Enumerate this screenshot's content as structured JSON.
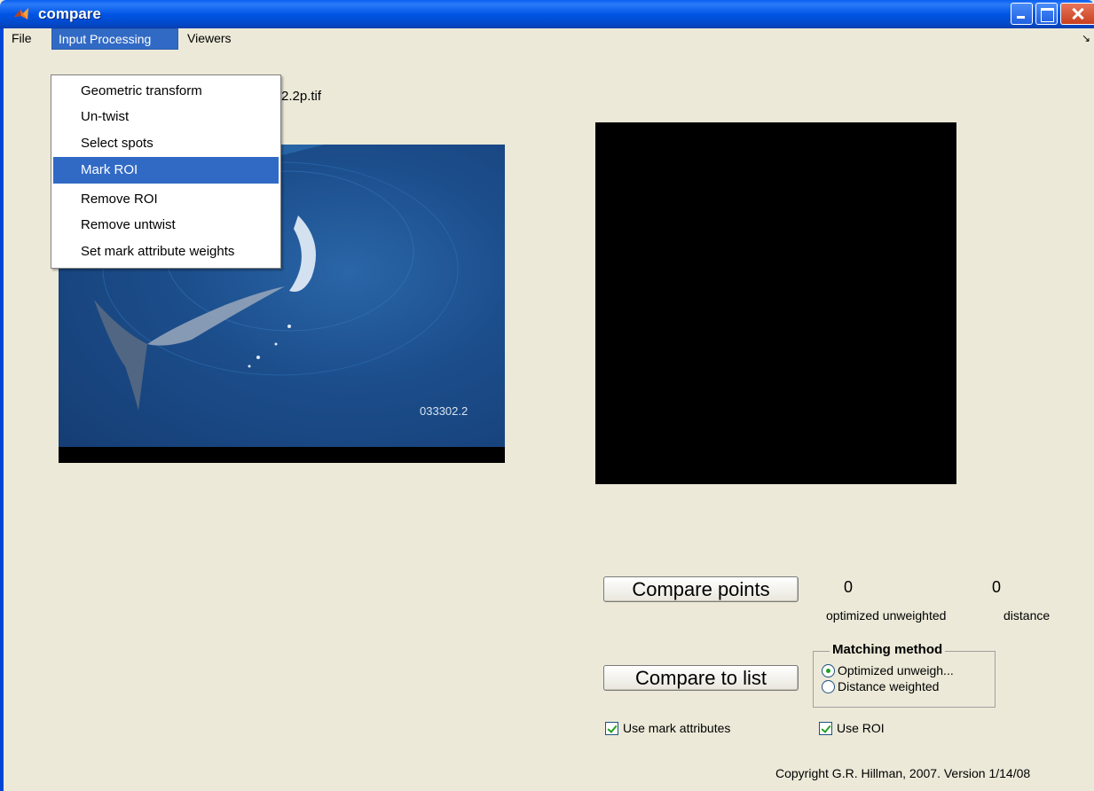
{
  "window": {
    "title": "compare"
  },
  "menubar": {
    "items": [
      {
        "label": "File"
      },
      {
        "label": "Input Processing"
      },
      {
        "label": "Viewers"
      }
    ]
  },
  "dropdown": {
    "items": [
      {
        "label": "Geometric transform"
      },
      {
        "label": "Un-twist"
      },
      {
        "label": "Select spots"
      },
      {
        "label": "Mark ROI",
        "selected": true
      },
      {
        "label": "Remove ROI"
      },
      {
        "label": "Remove untwist"
      },
      {
        "label": "Set mark attribute weights"
      }
    ]
  },
  "left_panel": {
    "filename_visible": "2.2p.tif",
    "image_label": "033302.2"
  },
  "compare": {
    "compare_points_label": "Compare points",
    "compare_list_label": "Compare to list",
    "value_unweighted": "0",
    "value_distance": "0",
    "label_unweighted": "optimized unweighted",
    "label_distance": "distance"
  },
  "matching_method": {
    "title": "Matching method",
    "options": [
      {
        "label": "Optimized unweigh...",
        "checked": true
      },
      {
        "label": "Distance weighted",
        "checked": false
      }
    ]
  },
  "checkboxes": {
    "use_mark_attributes": {
      "label": "Use mark attributes",
      "checked": true
    },
    "use_roi": {
      "label": "Use ROI",
      "checked": true
    }
  },
  "footer": {
    "copyright": "Copyright G.R. Hillman, 2007. Version 1/14/08"
  },
  "colors": {
    "titlebar": "#0055e5",
    "menu_highlight": "#316ac5",
    "background": "#ece9d8"
  }
}
